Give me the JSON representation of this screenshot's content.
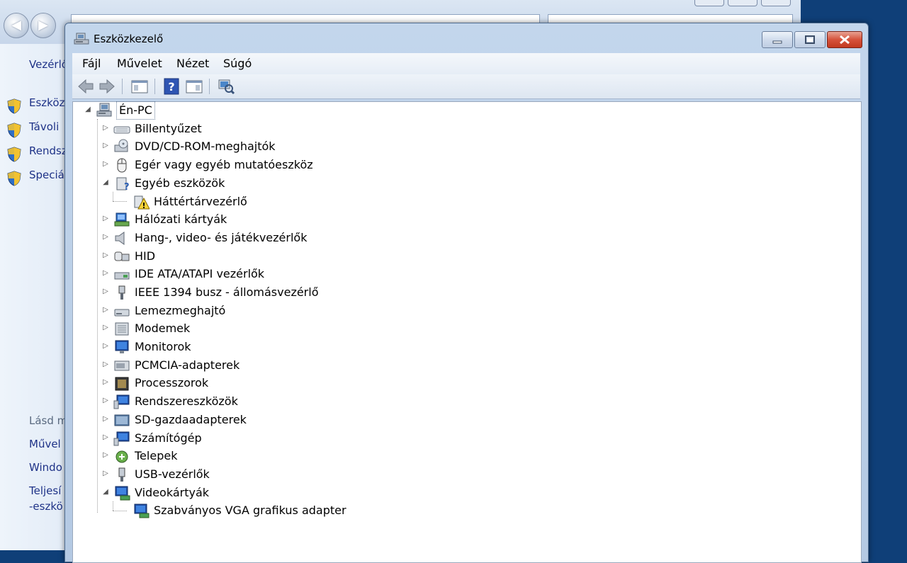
{
  "background_window": {
    "side_items": [
      {
        "label": "Vezérlő",
        "shield": false
      },
      {
        "label": "Eszköz",
        "shield": true
      },
      {
        "label": "Távoli",
        "shield": true
      },
      {
        "label": "Rendsz",
        "shield": true
      },
      {
        "label": "Speciá",
        "shield": true
      }
    ],
    "see_also": "Lásd m",
    "see_also_links": [
      "Művel",
      "Windo",
      "Teljesí",
      "-eszkö"
    ]
  },
  "window": {
    "title": "Eszközkezelő",
    "menu": [
      "Fájl",
      "Művelet",
      "Nézet",
      "Súgó"
    ],
    "toolbar": [
      "back-icon",
      "forward-icon",
      "show-hide-console-tree-icon",
      "help-icon",
      "properties-icon",
      "scan-hardware-icon"
    ]
  },
  "tree": {
    "root": "Én-PC",
    "categories": [
      {
        "label": "Billentyűzet",
        "icon": "keyboard-icon",
        "expanded": false
      },
      {
        "label": "DVD/CD-ROM-meghajtók",
        "icon": "dvd-drive-icon",
        "expanded": false
      },
      {
        "label": "Egér vagy egyéb mutatóeszköz",
        "icon": "mouse-icon",
        "expanded": false
      },
      {
        "label": "Egyéb eszközök",
        "icon": "unknown-device-icon",
        "expanded": true,
        "children": [
          {
            "label": "Háttértárvezérlő",
            "icon": "warning-device-icon"
          }
        ]
      },
      {
        "label": "Hálózati kártyák",
        "icon": "network-adapter-icon",
        "expanded": false
      },
      {
        "label": "Hang-, video- és játékvezérlők",
        "icon": "speaker-icon",
        "expanded": false
      },
      {
        "label": "HID",
        "icon": "hid-icon",
        "expanded": false
      },
      {
        "label": "IDE ATA/ATAPI vezérlők",
        "icon": "ide-controller-icon",
        "expanded": false
      },
      {
        "label": "IEEE 1394 busz - állomásvezérlő",
        "icon": "firewire-icon",
        "expanded": false
      },
      {
        "label": "Lemezmeghajtó",
        "icon": "disk-drive-icon",
        "expanded": false
      },
      {
        "label": "Modemek",
        "icon": "modem-icon",
        "expanded": false
      },
      {
        "label": "Monitorok",
        "icon": "monitor-icon",
        "expanded": false
      },
      {
        "label": "PCMCIA-adapterek",
        "icon": "pcmcia-icon",
        "expanded": false
      },
      {
        "label": "Processzorok",
        "icon": "processor-icon",
        "expanded": false
      },
      {
        "label": "Rendszereszközök",
        "icon": "system-devices-icon",
        "expanded": false
      },
      {
        "label": "SD-gazdaadapterek",
        "icon": "sd-host-icon",
        "expanded": false
      },
      {
        "label": "Számítógép",
        "icon": "computer-icon",
        "expanded": false
      },
      {
        "label": "Telepek",
        "icon": "battery-icon",
        "expanded": false
      },
      {
        "label": "USB-vezérlők",
        "icon": "usb-icon",
        "expanded": false
      },
      {
        "label": "Videokártyák",
        "icon": "display-adapter-icon",
        "expanded": true,
        "children": [
          {
            "label": "Szabványos VGA grafikus adapter",
            "icon": "display-adapter-icon"
          }
        ]
      }
    ]
  }
}
